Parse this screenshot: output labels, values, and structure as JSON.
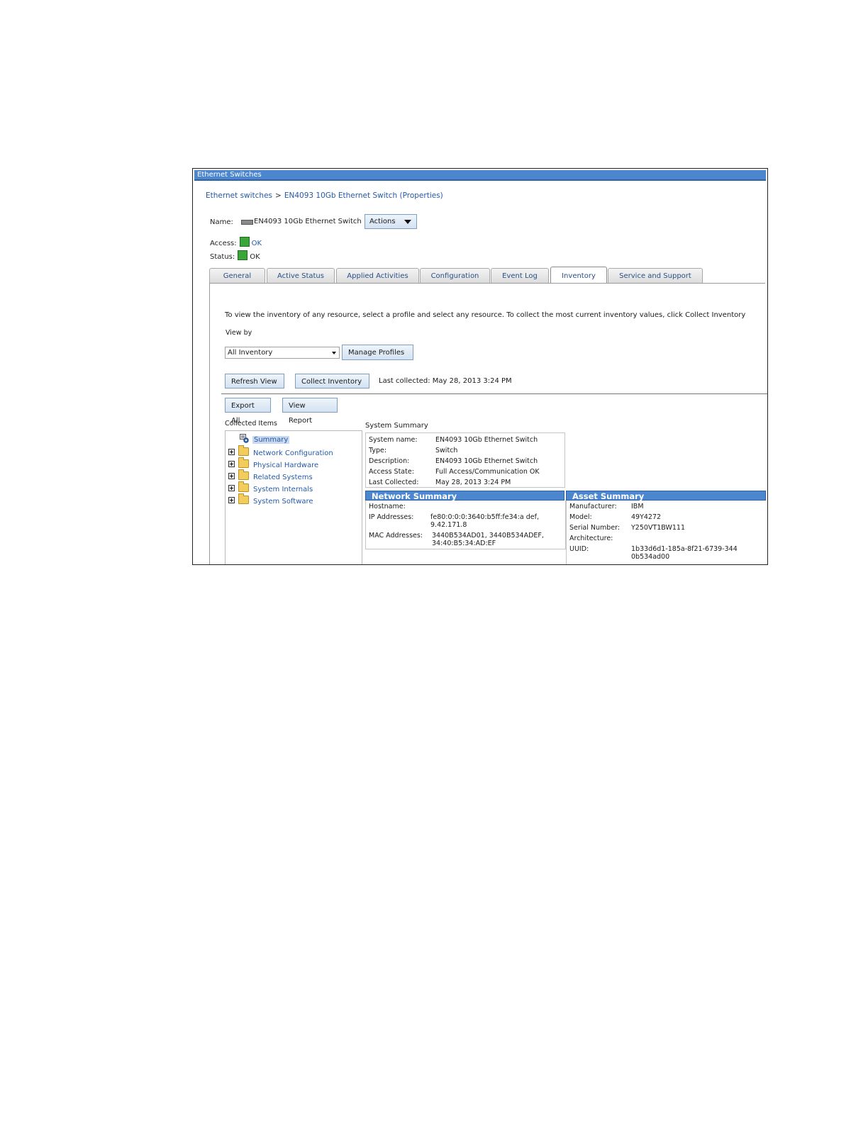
{
  "window": {
    "title": "Ethernet Switches"
  },
  "breadcrumb": {
    "root": "Ethernet switches",
    "separator": ">",
    "current": "EN4093 10Gb Ethernet Switch (Properties)"
  },
  "resource": {
    "name_label": "Name:",
    "name": "EN4093 10Gb Ethernet Switch",
    "actions_label": "Actions",
    "access_label": "Access:",
    "access_value": "OK",
    "status_label": "Status:",
    "status_value": "OK"
  },
  "tabs": [
    {
      "label": "General"
    },
    {
      "label": "Active Status"
    },
    {
      "label": "Applied Activities"
    },
    {
      "label": "Configuration"
    },
    {
      "label": "Event Log"
    },
    {
      "label": "Inventory",
      "active": true
    },
    {
      "label": "Service and Support"
    }
  ],
  "inventory": {
    "instructions": "To view the inventory of any resource, select a profile and select any resource. To collect the most current inventory values, click Collect Inventory",
    "view_by_label": "View by",
    "view_by_selected": "All Inventory",
    "manage_profiles_label": "Manage Profiles",
    "refresh_view_label": "Refresh View",
    "collect_inventory_label": "Collect Inventory",
    "last_collected": "Last collected: May 28, 2013 3:24 PM",
    "export_all_label": "Export All",
    "view_report_label": "View Report",
    "collected_items_label": "Collected Items",
    "tree": [
      {
        "label": "Summary",
        "selected": true
      },
      {
        "label": "Network Configuration"
      },
      {
        "label": "Physical Hardware"
      },
      {
        "label": "Related Systems"
      },
      {
        "label": "System Internals"
      },
      {
        "label": "System Software"
      }
    ]
  },
  "system_summary": {
    "title": "System Summary",
    "rows": [
      {
        "key": "System name:",
        "value": "EN4093 10Gb Ethernet Switch"
      },
      {
        "key": "Type:",
        "value": "Switch"
      },
      {
        "key": "Description:",
        "value": "EN4093 10Gb Ethernet Switch"
      },
      {
        "key": "Access State:",
        "value": "Full Access/Communication OK"
      },
      {
        "key": "Last Collected:",
        "value": "May 28, 2013 3:24 PM"
      }
    ]
  },
  "network_summary": {
    "title": "Network Summary",
    "hostname_key": "Hostname:",
    "hostname_value": "",
    "ip_key": "IP Addresses:",
    "ip_line1": "fe80:0:0:0:3640:b5ff:fe34:a def,",
    "ip_line2": "9.42.171.8",
    "mac_key": "MAC Addresses:",
    "mac_line1": "3440B534AD01, 3440B534ADEF,",
    "mac_line2": "34:40:B5:34:AD:EF"
  },
  "asset_summary": {
    "title": "Asset Summary",
    "manufacturer_key": "Manufacturer:",
    "manufacturer_value": "IBM",
    "model_key": "Model:",
    "model_value": "49Y4272",
    "serial_key": "Serial Number:",
    "serial_value": "Y250VT1BW111",
    "architecture_key": "Architecture:",
    "architecture_value": "",
    "uuid_key": "UUID:",
    "uuid_line1": "1b33d6d1-185a-8f21-6739-344",
    "uuid_line2": "0b534ad00"
  },
  "colors": {
    "title_bar": "#4b86cf",
    "link": "#2559a6",
    "status_ok": "#3aa63a",
    "section_header": "#4b86cf"
  }
}
